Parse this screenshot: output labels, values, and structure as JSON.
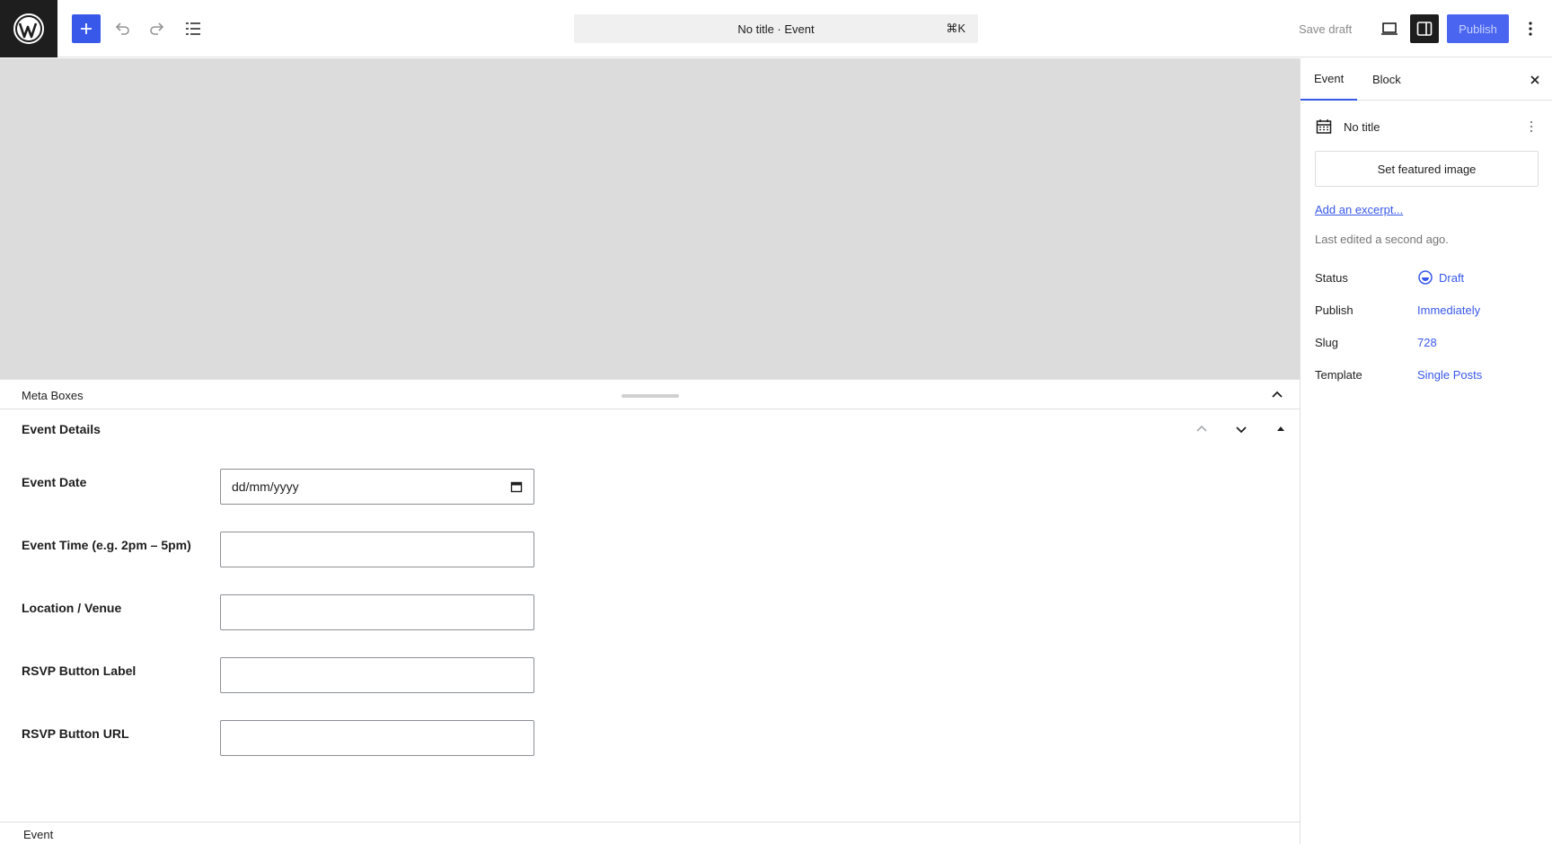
{
  "header": {
    "command_bar": {
      "text": "No title · Event",
      "shortcut": "⌘K"
    },
    "save_draft": "Save draft",
    "publish": "Publish",
    "accent_color": "#3858e9"
  },
  "meta_boxes": {
    "title": "Meta Boxes",
    "panel": {
      "title": "Event Details",
      "fields": [
        {
          "label": "Event Date",
          "value": "dd/mm/yyyy"
        },
        {
          "label": "Event Time (e.g. 2pm – 5pm)",
          "value": ""
        },
        {
          "label": "Location / Venue",
          "value": ""
        },
        {
          "label": "RSVP Button Label",
          "value": ""
        },
        {
          "label": "RSVP Button URL",
          "value": ""
        }
      ]
    }
  },
  "footer": {
    "breadcrumb": "Event"
  },
  "sidebar": {
    "tabs": [
      {
        "label": "Event"
      },
      {
        "label": "Block"
      }
    ],
    "post_title": "No title",
    "featured_image_button": "Set featured image",
    "excerpt_link": "Add an excerpt...",
    "last_edited": "Last edited a second ago.",
    "rows": [
      {
        "key": "Status",
        "value": "Draft"
      },
      {
        "key": "Publish",
        "value": "Immediately"
      },
      {
        "key": "Slug",
        "value": "728"
      },
      {
        "key": "Template",
        "value": "Single Posts"
      }
    ]
  }
}
